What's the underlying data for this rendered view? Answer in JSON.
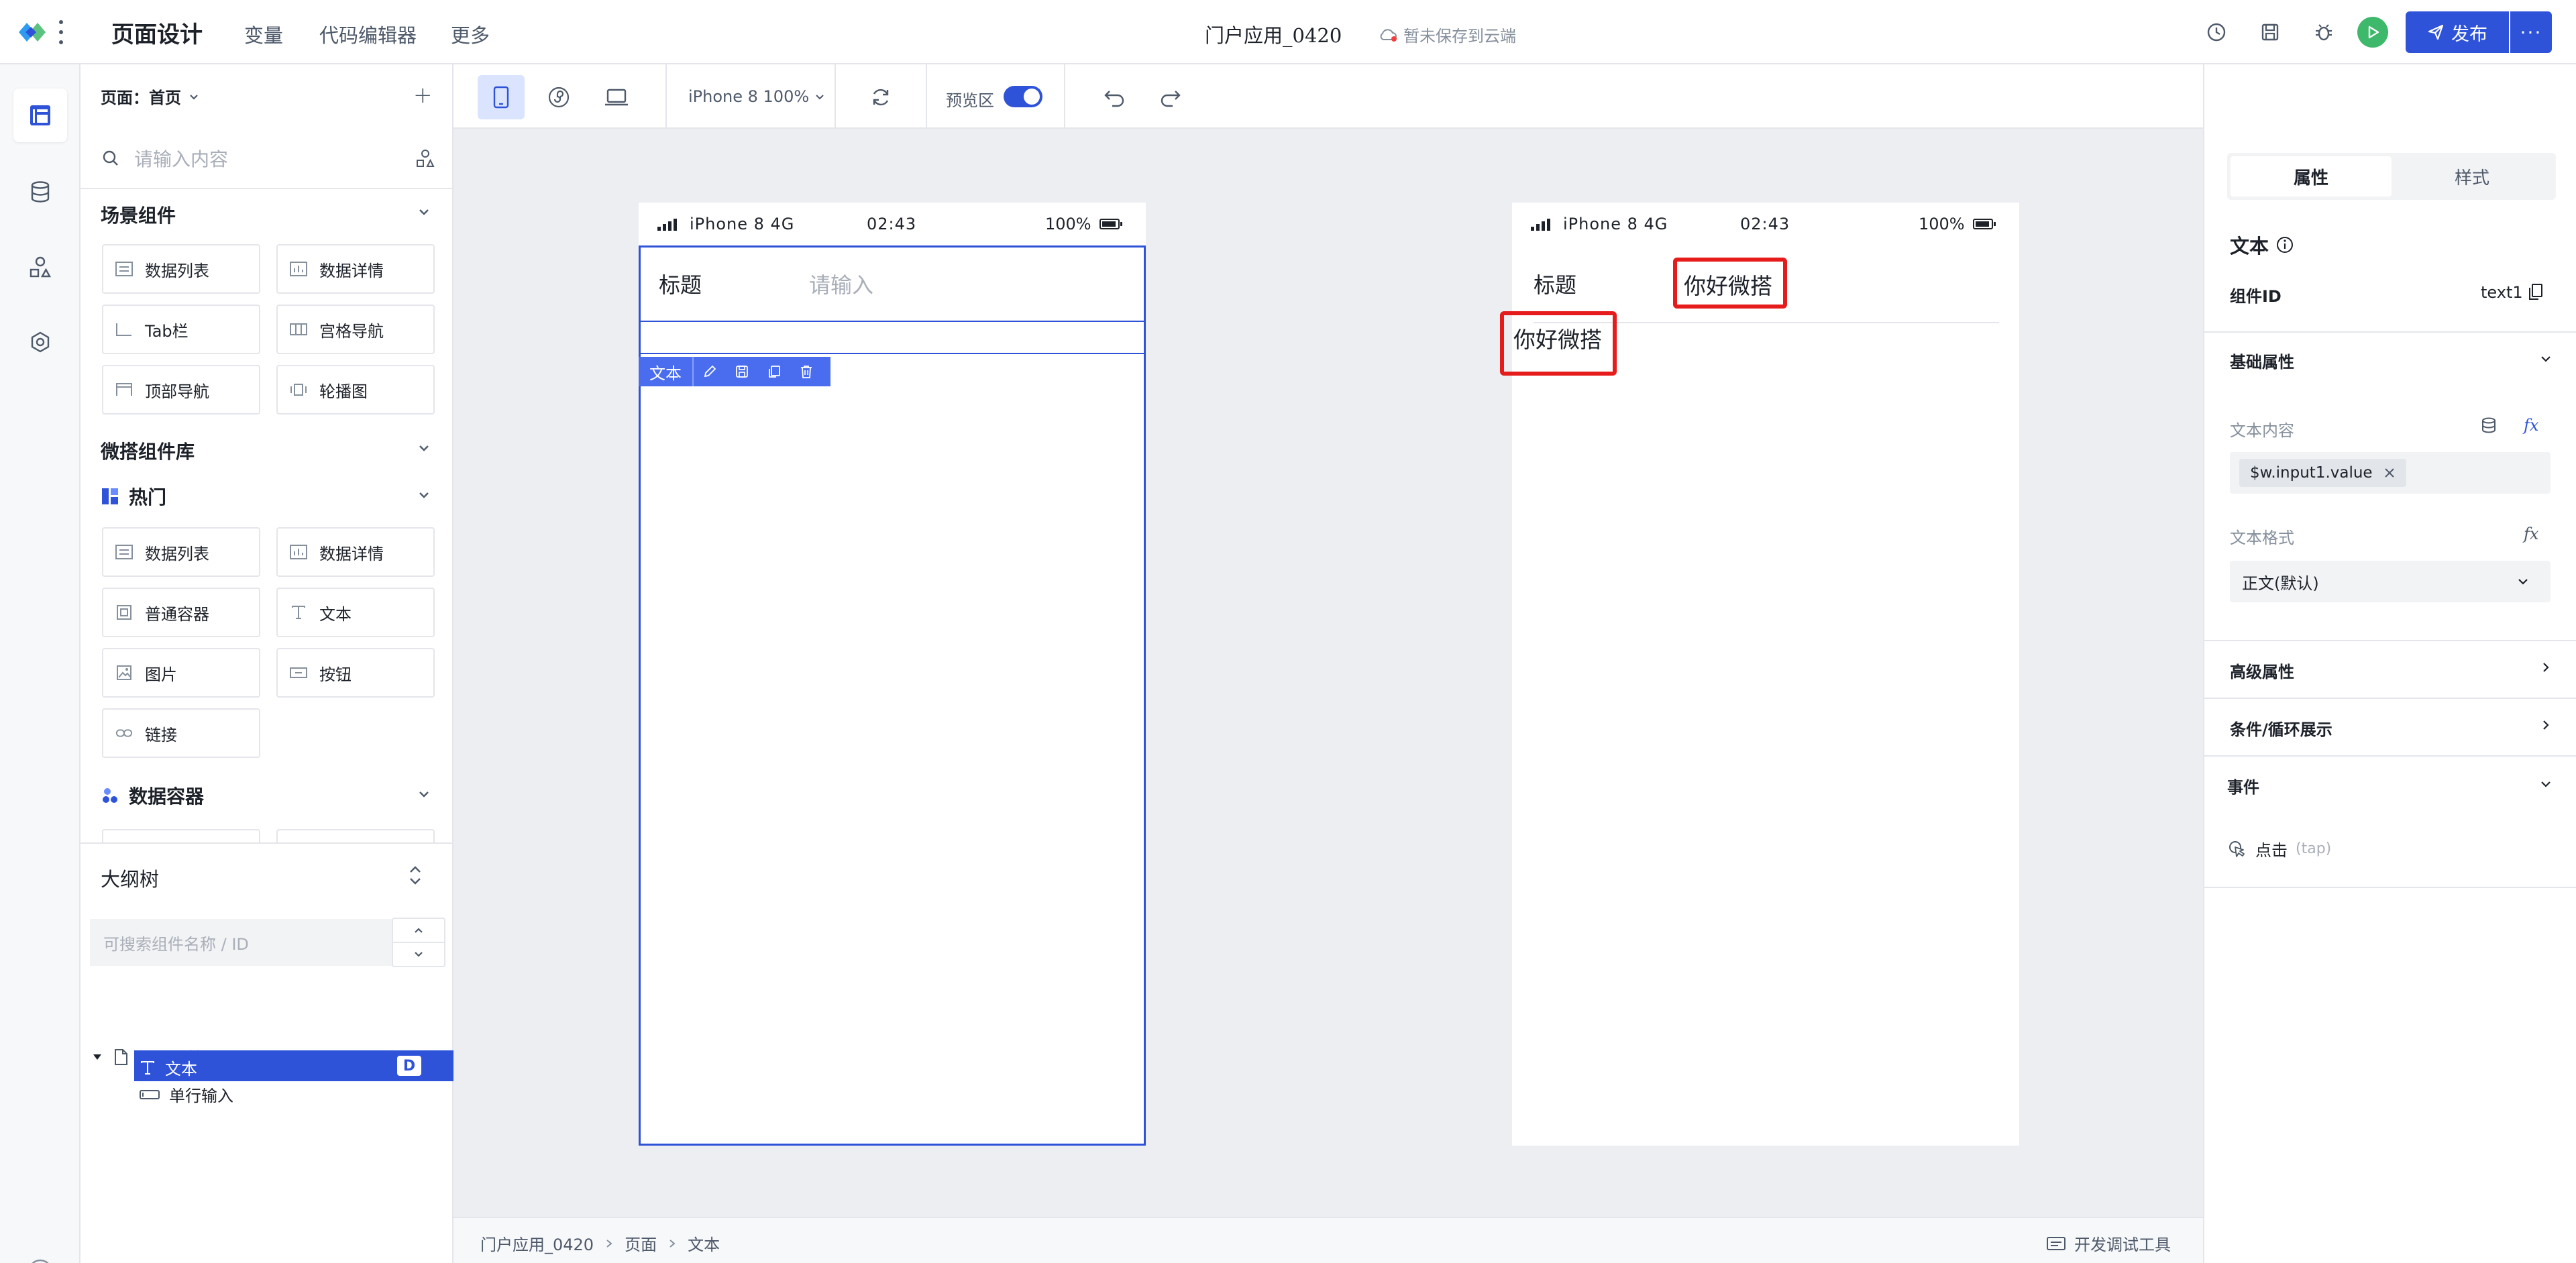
{
  "topbar": {
    "section_title": "页面设计",
    "nav": [
      "变量",
      "代码编辑器",
      "更多"
    ],
    "app_title": "门户应用_0420",
    "save_status": "暂未保存到云端",
    "publish_label": "发布"
  },
  "left_panel": {
    "page_selector": "页面：首页",
    "search_placeholder": "请输入内容",
    "scene_section": "场景组件",
    "scene_components": [
      "数据列表",
      "数据详情",
      "Tab栏",
      "宫格导航",
      "顶部导航",
      "轮播图"
    ],
    "library_section": "微搭组件库",
    "hot_section": "热门",
    "hot_components": [
      "数据列表",
      "数据详情",
      "普通容器",
      "文本",
      "图片",
      "按钮",
      "链接"
    ],
    "data_container_section": "数据容器"
  },
  "outline": {
    "title": "大纲树",
    "search_placeholder": "可搜索组件名称 / ID",
    "nodes": [
      "页面：首页",
      "单行输入",
      "文本"
    ],
    "badge": "D"
  },
  "toolbar": {
    "device": "iPhone 8 100%",
    "preview_label": "预览区"
  },
  "phone": {
    "carrier": "iPhone 8  4G",
    "time": "02:43",
    "battery": "100%"
  },
  "editor_phone": {
    "label": "标题",
    "placeholder": "请输入",
    "component_tag": "文本"
  },
  "preview_phone": {
    "label": "标题",
    "input_value": "你好微搭",
    "text_value": "你好微搭"
  },
  "breadcrumb": [
    "门户应用_0420",
    "页面",
    "文本"
  ],
  "devtools_label": "开发调试工具",
  "right_panel": {
    "tabs": [
      "属性",
      "样式"
    ],
    "component_title": "文本",
    "id_label": "组件ID",
    "id_value": "text1",
    "basic_section": "基础属性",
    "content_label": "文本内容",
    "content_binding": "$w.input1.value",
    "format_label": "文本格式",
    "format_value": "正文(默认)",
    "advanced_section": "高级属性",
    "condition_section": "条件/循环展示",
    "events_section": "事件",
    "event_click": "点击",
    "event_tap": "(tap)",
    "fx": "fx"
  },
  "colors": {
    "primary": "#2e53d9",
    "highlight": "#e61b1b",
    "run_green": "#3eb86a"
  }
}
